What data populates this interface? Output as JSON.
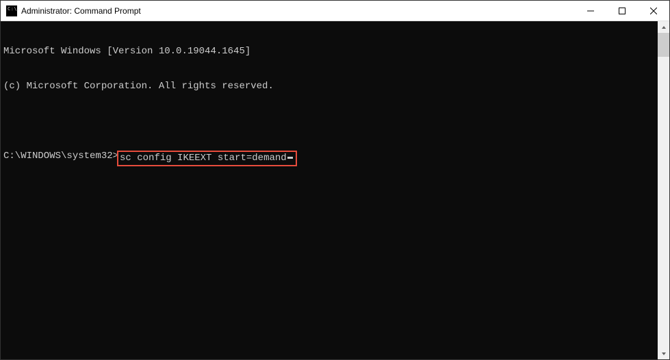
{
  "titlebar": {
    "title": "Administrator: Command Prompt"
  },
  "terminal": {
    "line1": "Microsoft Windows [Version 10.0.19044.1645]",
    "line2": "(c) Microsoft Corporation. All rights reserved.",
    "prompt": "C:\\WINDOWS\\system32>",
    "command": "sc config IKEEXT start=demand"
  },
  "icons": {
    "cmd_text": "C:\\."
  }
}
